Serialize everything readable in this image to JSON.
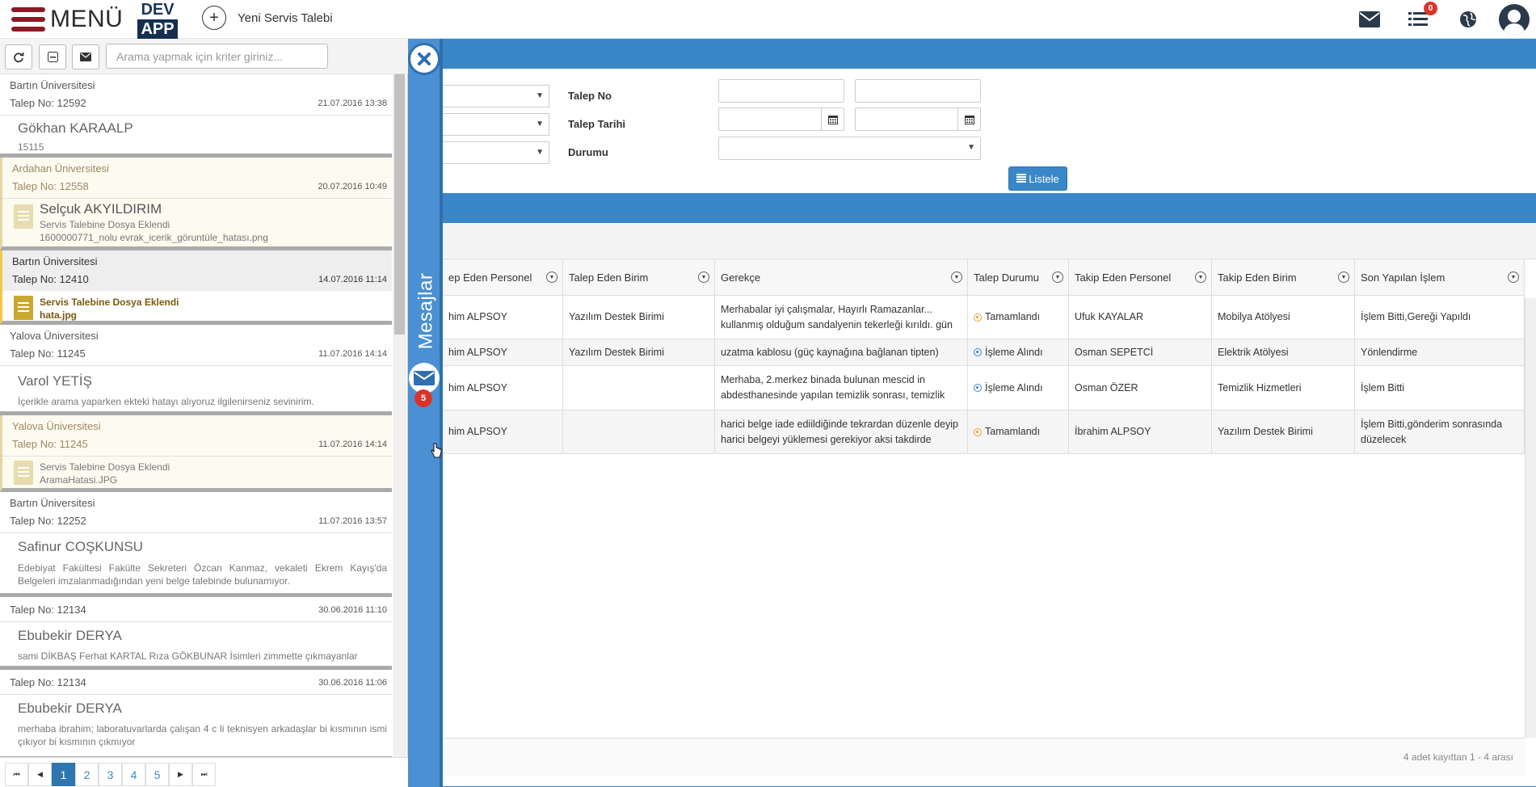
{
  "topbar": {
    "menu_label": "MENÜ",
    "logo_top": "DEV",
    "logo_bottom": "APP",
    "new_request_label": "Yeni Servis Talebi",
    "task_badge": "0"
  },
  "icons": {
    "menu": "hamburger-icon",
    "new": "plus-circle-icon",
    "mail": "envelope-icon",
    "tasks": "list-icon",
    "globe": "globe-icon",
    "user": "user-avatar-icon",
    "refresh": "refresh-icon",
    "collapse": "minus-square-icon",
    "compose": "envelope-icon",
    "close": "close-icon",
    "calendar": "calendar-icon",
    "filter": "filter-icon",
    "file": "file-icon"
  },
  "colors": {
    "brand_red": "#8b1a24",
    "brand_blue": "#3a87c8",
    "badge_red": "#d9342b",
    "status_done": "#f0a030",
    "status_in_progress": "#3a87c8"
  },
  "drawer": {
    "search_placeholder": "Arama yapmak için kriter giriniz...",
    "side_label": "Mesajlar",
    "unread_count": "5",
    "messages": [
      {
        "university": "Bartın Üniversitesi",
        "request_no": "Talep No: 12592",
        "date": "21.07.2016 13:38",
        "name": "Gökhan KARAALP",
        "text": "15115"
      },
      {
        "university": "Ardahan Üniversitesi",
        "request_no": "Talep No: 12558",
        "date": "20.07.2016 10:49",
        "name": "Selçuk AKYILDIRIM",
        "file_title": "Servis Talebine Dosya Eklendi",
        "file_name": "1600000771_nolu evrak_icerik_göruntüle_hatası.png"
      },
      {
        "university": "Bartın Üniversitesi",
        "request_no": "Talep No: 12410",
        "date": "14.07.2016 11:14",
        "file_title": "Servis Talebine Dosya Eklendi",
        "file_name": "hata.jpg"
      },
      {
        "university": "Yalova Üniversitesi",
        "request_no": "Talep No: 11245",
        "date": "11.07.2016 14:14",
        "name": "Varol YETİŞ",
        "text": "İçerikle arama yaparken ekteki hatayı alıyoruz ilgilenirseniz sevinirim."
      },
      {
        "university": "Yalova Üniversitesi",
        "request_no": "Talep No: 11245",
        "date": "11.07.2016 14:14",
        "file_title": "Servis Talebine Dosya Eklendi",
        "file_name": "AramaHatasi.JPG"
      },
      {
        "university": "Bartın Üniversitesi",
        "request_no": "Talep No: 12252",
        "date": "11.07.2016 13:57",
        "name": "Safinur COŞKUNSU",
        "text": "Edebiyat Fakültesi Fakülte Sekreteri Özcan Kanmaz, vekaleti Ekrem Kayış'da Belgeleri imzalanmadığından yeni belge talebinde bulunamıyor."
      },
      {
        "request_no": "Talep No: 12134",
        "date": "30.06.2016 11:10",
        "name": "Ebubekir DERYA",
        "text": "sami DİKBAŞ Ferhat KARTAL Rıza GÖKBUNAR İsimleri zimmette çıkmayanlar"
      },
      {
        "request_no": "Talep No: 12134",
        "date": "30.06.2016 11:06",
        "name": "Ebubekir DERYA",
        "text": "merhaba ibrahim; laboratuvarlarda çalışan 4 c li teknisyen arkadaşlar bi kısmının ismi çıkıyor bi kısmının çıkmıyor"
      }
    ],
    "pager": {
      "first": "⏮",
      "prev": "◀",
      "pages": [
        "1",
        "2",
        "3",
        "4",
        "5"
      ],
      "current": "1",
      "next": "▶",
      "last": "⏭"
    }
  },
  "filter": {
    "request_no_label": "Talep No",
    "request_date_label": "Talep Tarihi",
    "status_label": "Durumu",
    "list_button": "Listele"
  },
  "grid": {
    "columns": [
      "ep Eden Personel",
      "Talep Eden Birim",
      "Gerekçe",
      "Talep Durumu",
      "Takip Eden Personel",
      "Takip Eden Birim",
      "Son Yapılan İşlem"
    ],
    "rows": [
      {
        "personnel": "him ALPSOY",
        "unit": "Yazılım Destek Birimi",
        "reason": "Merhabalar iyi çalışmalar, Hayırlı Ramazanlar... kullanmış olduğum sandalyenin tekerleği kırıldı. gün",
        "status": "Tamamlandı",
        "status_kind": "done",
        "followed_by": "Ufuk KAYALAR",
        "followed_unit": "Mobilya Atölyesi",
        "last_action": "İşlem Bitti,Gereği Yapıldı"
      },
      {
        "personnel": "him ALPSOY",
        "unit": "Yazılım Destek Birimi",
        "reason": "uzatma kablosu (güç kaynağına bağlanan tipten)",
        "status": "İşleme Alındı",
        "status_kind": "progress",
        "followed_by": "Osman SEPETCİ",
        "followed_unit": "Elektrik Atölyesi",
        "last_action": "Yönlendirme"
      },
      {
        "personnel": "him ALPSOY",
        "unit": "",
        "reason": "Merhaba, 2.merkez binada bulunan mescid in abdesthanesinde yapılan temizlik sonrası, temizlik",
        "status": "İşleme Alındı",
        "status_kind": "progress",
        "followed_by": "Osman ÖZER",
        "followed_unit": "Temizlik Hizmetleri",
        "last_action": "İşlem Bitti"
      },
      {
        "personnel": "him ALPSOY",
        "unit": "",
        "reason": "harici belge iade ediildiğinde tekrardan düzenle deyip harici belgeyi yüklemesi gerekiyor aksi takdirde",
        "status": "Tamamlandı",
        "status_kind": "done",
        "followed_by": "İbrahim ALPSOY",
        "followed_unit": "Yazılım Destek Birimi",
        "last_action": "İşlem Bitti,gönderim sonrasında düzelecek"
      }
    ],
    "summary": "4 adet kayıttan 1 - 4 arası"
  }
}
